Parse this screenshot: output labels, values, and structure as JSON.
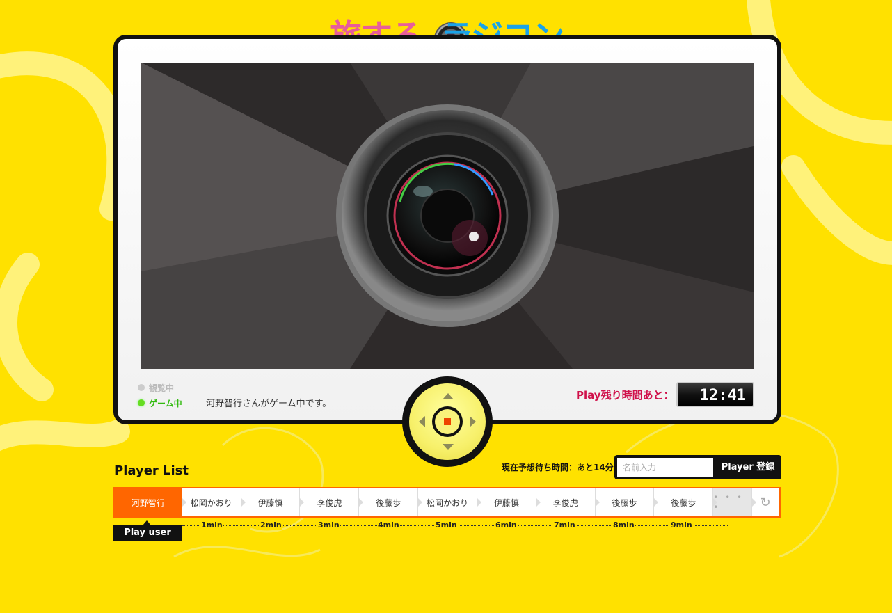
{
  "logo": {
    "left_text": "旅する",
    "right_text": "ラジコン"
  },
  "status": {
    "watching_label": "観覧中",
    "playing_label": "ゲーム中",
    "message": "河野智行さんがゲーム中です。"
  },
  "timer": {
    "label": "Play残り時間あと：",
    "value": "12:41"
  },
  "player_list": {
    "title": "Player List",
    "wait_time": "現在予想待ち時間：あと14分",
    "name_placeholder": "名前入力",
    "register_label": "Player 登録",
    "current_player": "河野智行",
    "queue": [
      "松岡かおり",
      "伊藤慎",
      "李俊虎",
      "後藤歩",
      "松岡かおり",
      "伊藤慎",
      "李俊虎",
      "後藤歩",
      "後藤歩"
    ],
    "more_label": "• • • •",
    "play_user_label": "Play user",
    "ticks": [
      "1min",
      "2min",
      "3min",
      "4min",
      "5min",
      "6min",
      "7min",
      "8min",
      "9min"
    ]
  },
  "icons": {
    "refresh": "refresh-icon",
    "stop": "stop-icon"
  },
  "colors": {
    "background": "#ffe100",
    "accent": "#ff6600",
    "timer_label": "#d0104a",
    "playing": "#33bb11"
  }
}
